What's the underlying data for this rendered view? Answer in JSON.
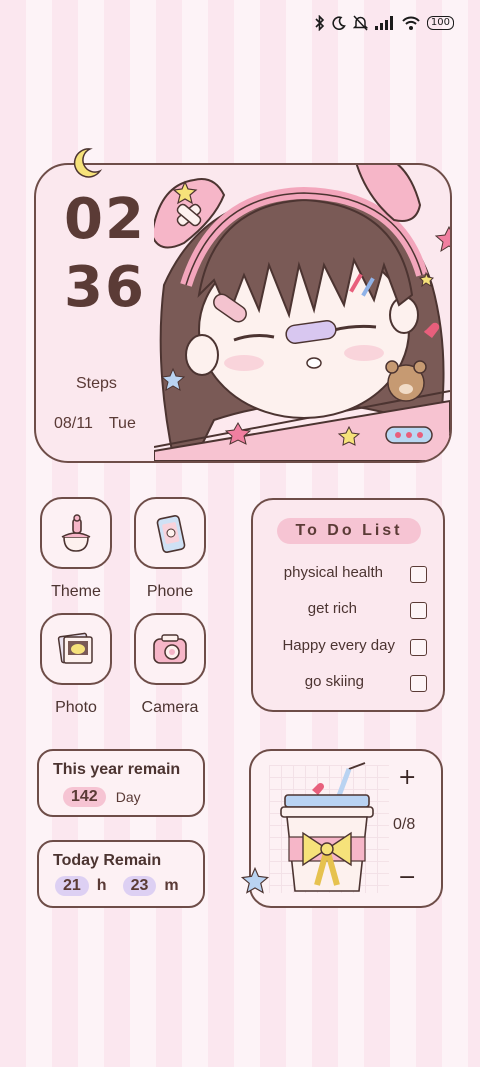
{
  "status_bar": {
    "battery": "100",
    "icons": [
      "bluetooth-icon",
      "moon-icon",
      "bell-off-icon",
      "signal-icon",
      "wifi-icon"
    ]
  },
  "clock": {
    "hours": "02",
    "minutes": "36",
    "steps_label": "Steps",
    "date": "08/11",
    "weekday": "Tue"
  },
  "apps": [
    {
      "label": "Theme",
      "icon": "theme-icon"
    },
    {
      "label": "Phone",
      "icon": "phone-icon"
    },
    {
      "label": "Photo",
      "icon": "photo-icon"
    },
    {
      "label": "Camera",
      "icon": "camera-icon"
    }
  ],
  "todo": {
    "title": "To Do List",
    "items": [
      "physical health",
      "get rich",
      "Happy every day",
      "go skiing"
    ]
  },
  "year_remain": {
    "title": "This year remain",
    "value": "142",
    "unit": "Day"
  },
  "today_remain": {
    "title": "Today Remain",
    "hours": "21",
    "hours_unit": "h",
    "minutes": "23",
    "minutes_unit": "m"
  },
  "water": {
    "plus": "+",
    "minus": "−",
    "count": "0/8"
  },
  "colors": {
    "accent_pink": "#f6c4d3",
    "border_brown": "#6e4d48",
    "purple_pill": "#ddd0f3"
  }
}
